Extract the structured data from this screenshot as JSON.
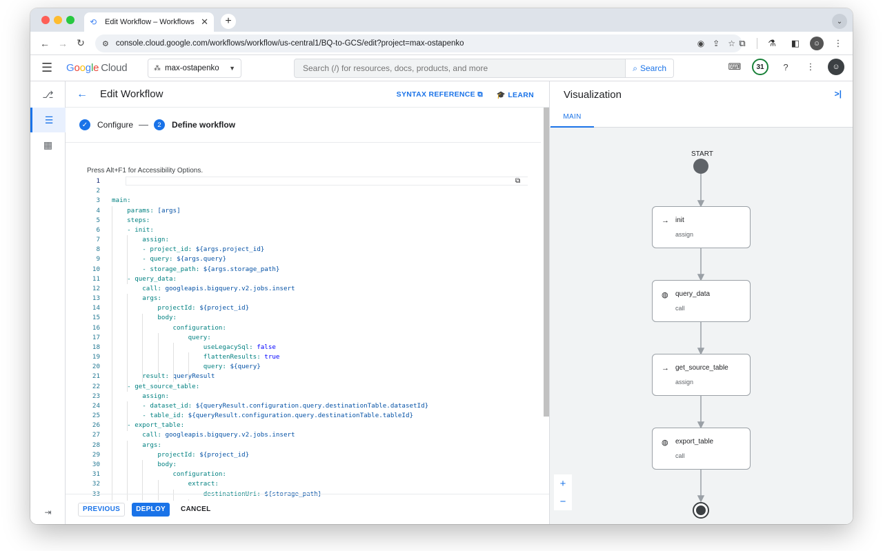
{
  "browser": {
    "tab_title": "Edit Workflow – Workflows – m",
    "tab_close": "✕",
    "new_tab": "+",
    "url": "console.cloud.google.com/workflows/workflow/us-central1/BQ-to-GCS/edit?project=max-ostapenko"
  },
  "header": {
    "logo_google": [
      "G",
      "o",
      "o",
      "g",
      "l",
      "e"
    ],
    "logo_cloud": "Cloud",
    "project": "max-ostapenko",
    "search_placeholder": "Search (/) for resources, docs, products, and more",
    "search_button": "Search",
    "notifications_count": "31"
  },
  "editor": {
    "title": "Edit Workflow",
    "syntax_reference": "SYNTAX REFERENCE",
    "learn": "LEARN",
    "steps": [
      {
        "label": "Configure",
        "state": "done"
      },
      {
        "number": "2",
        "label": "Define workflow",
        "state": "active"
      }
    ],
    "a11y_hint": "Press Alt+F1 for Accessibility Options.",
    "code_lines": [
      "",
      "",
      "main:",
      "    params: [args]",
      "    steps:",
      "    - init:",
      "        assign:",
      "        - project_id: ${args.project_id}",
      "        - query: ${args.query}",
      "        - storage_path: ${args.storage_path}",
      "    - query_data:",
      "        call: googleapis.bigquery.v2.jobs.insert",
      "        args:",
      "            projectId: ${project_id}",
      "            body:",
      "                configuration:",
      "                    query:",
      "                        useLegacySql: false",
      "                        flattenResults: true",
      "                        query: ${query}",
      "        result: queryResult",
      "    - get_source_table:",
      "        assign:",
      "        - dataset_id: ${queryResult.configuration.query.destinationTable.datasetId}",
      "        - table_id: ${queryResult.configuration.query.destinationTable.tableId}",
      "    - export_table:",
      "        call: googleapis.bigquery.v2.jobs.insert",
      "        args:",
      "            projectId: ${project_id}",
      "            body:",
      "                configuration:",
      "                    extract:",
      "                        destinationUri: ${storage_path}"
    ],
    "footer": {
      "previous": "PREVIOUS",
      "deploy": "DEPLOY",
      "cancel": "CANCEL"
    }
  },
  "visualization": {
    "title": "Visualization",
    "tab": "MAIN",
    "start_label": "START",
    "nodes": [
      {
        "name": "init",
        "type": "assign",
        "icon": "arrow-right-icon"
      },
      {
        "name": "query_data",
        "type": "call",
        "icon": "globe-icon"
      },
      {
        "name": "get_source_table",
        "type": "assign",
        "icon": "arrow-right-icon"
      },
      {
        "name": "export_table",
        "type": "call",
        "icon": "globe-icon"
      }
    ],
    "zoom_in": "+",
    "zoom_out": "−"
  },
  "colors": {
    "accent": "#1a73e8",
    "badge_ring": "#188038"
  }
}
